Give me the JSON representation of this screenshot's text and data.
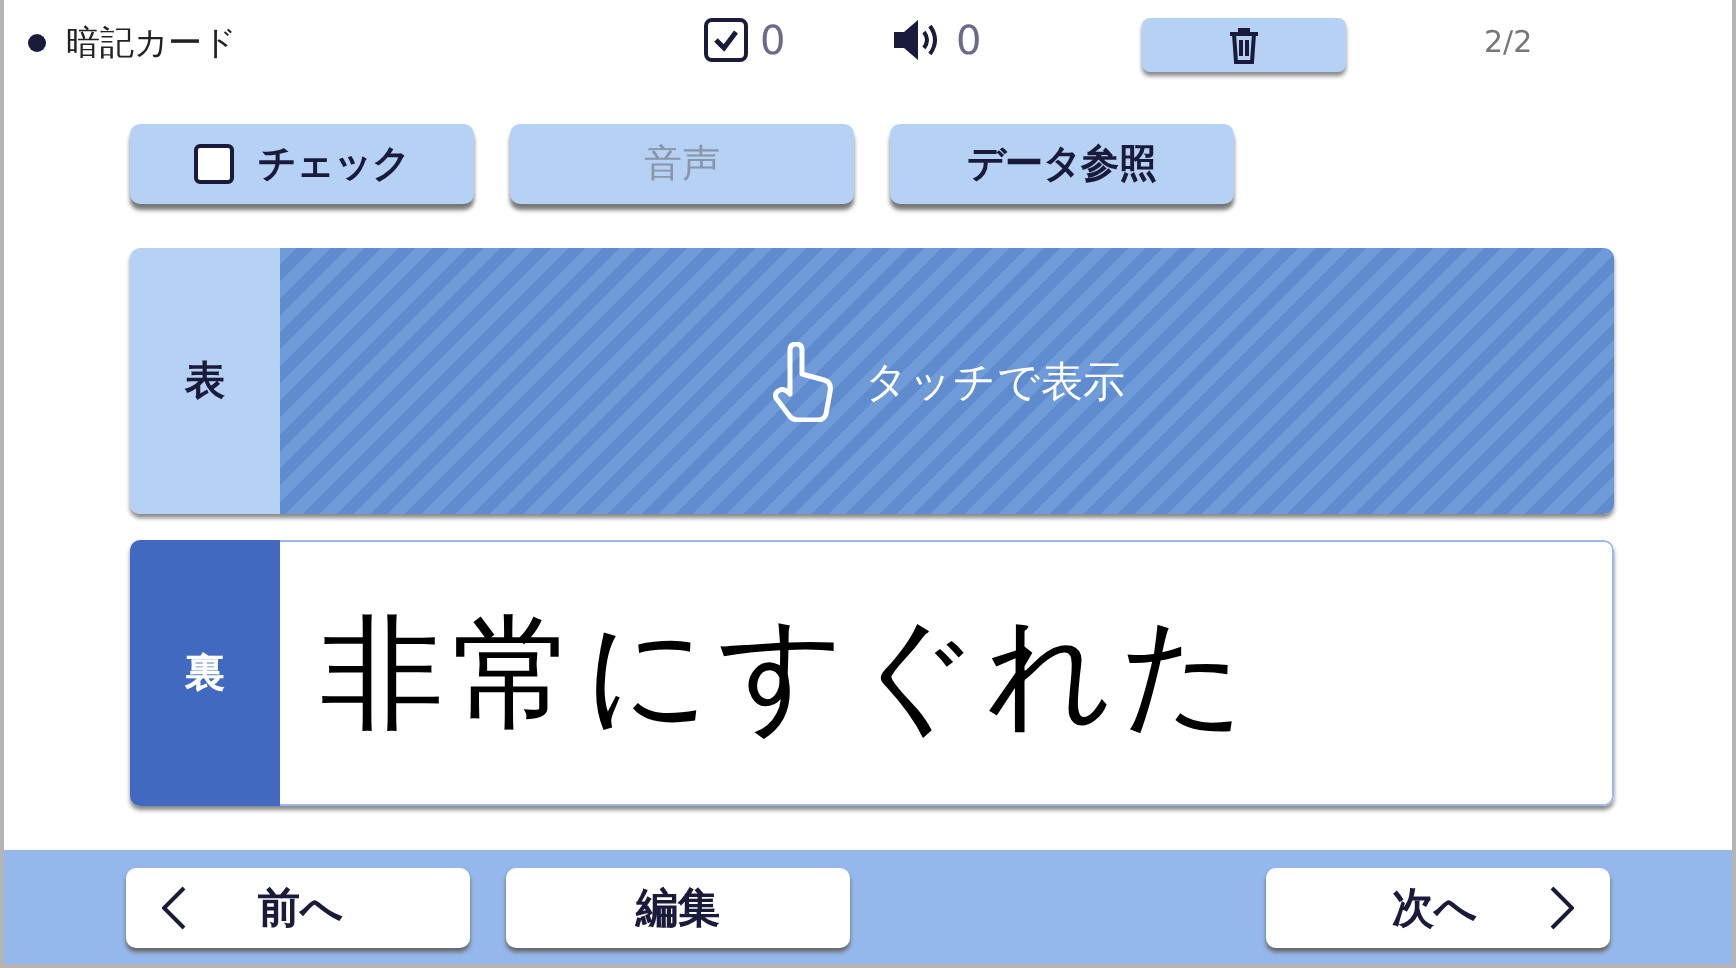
{
  "header": {
    "title": "暗記カード",
    "check_count": "0",
    "audio_count": "0",
    "page": "2/2"
  },
  "toolbar": [
    {
      "kind": "check",
      "label": "チェック",
      "checked": false,
      "disabled": false
    },
    {
      "kind": "plain",
      "label": "音声",
      "disabled": true
    },
    {
      "kind": "plain",
      "label": "データ参照",
      "disabled": false
    }
  ],
  "front": {
    "side": "表",
    "hint": "タッチで表示",
    "hidden": true
  },
  "back": {
    "side": "裏",
    "handwriting": "非常にすぐれた"
  },
  "footer": [
    {
      "kind": "prev",
      "label": "前へ"
    },
    {
      "kind": "plain",
      "label": "編集"
    },
    {
      "kind": "spacer"
    },
    {
      "kind": "next",
      "label": "次へ"
    }
  ]
}
